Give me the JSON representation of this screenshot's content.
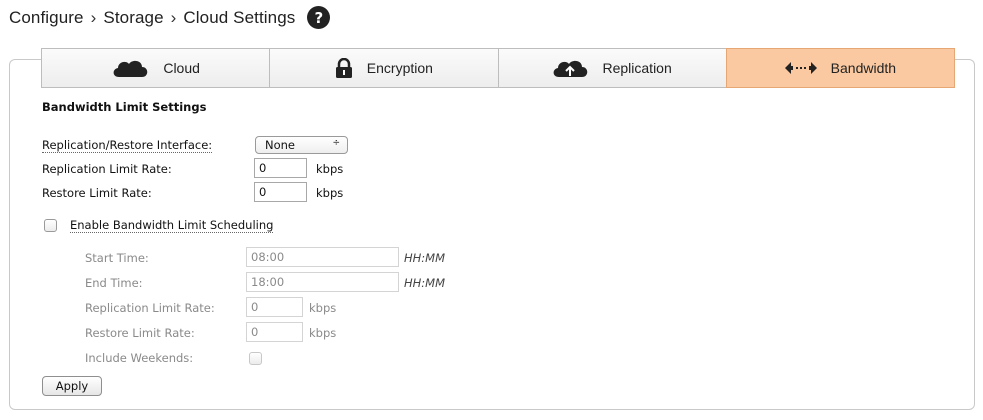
{
  "breadcrumb": {
    "items": [
      "Configure",
      "Storage",
      "Cloud Settings"
    ],
    "separator": "›",
    "help_label": "?"
  },
  "tabs": [
    {
      "label": "Cloud",
      "icon": "cloud-icon",
      "active": false
    },
    {
      "label": "Encryption",
      "icon": "lock-icon",
      "active": false
    },
    {
      "label": "Replication",
      "icon": "cloud-upload-icon",
      "active": false
    },
    {
      "label": "Bandwidth",
      "icon": "bidirectional-arrow-icon",
      "active": true
    }
  ],
  "form": {
    "section_title": "Bandwidth Limit Settings",
    "interface_label": "Replication/Restore Interface:",
    "interface_value": "None",
    "interface_arrows": "÷",
    "replication_rate_label": "Replication Limit Rate:",
    "replication_rate_value": "0",
    "restore_rate_label": "Restore Limit Rate:",
    "restore_rate_value": "0",
    "unit": "kbps",
    "schedule_label": "Enable Bandwidth Limit Scheduling",
    "schedule_checked": false
  },
  "schedule": {
    "start_label": "Start Time:",
    "start_value": "08:00",
    "end_label": "End Time:",
    "end_value": "18:00",
    "time_format": "HH:MM",
    "replication_rate_label": "Replication Limit Rate:",
    "replication_rate_value": "0",
    "restore_rate_label": "Restore Limit Rate:",
    "restore_rate_value": "0",
    "unit": "kbps",
    "weekends_label": "Include Weekends:",
    "weekends_checked": false
  },
  "apply_label": "Apply",
  "colors": {
    "active_tab": "#fbc9a1",
    "disabled_text": "#8a8a8a"
  }
}
